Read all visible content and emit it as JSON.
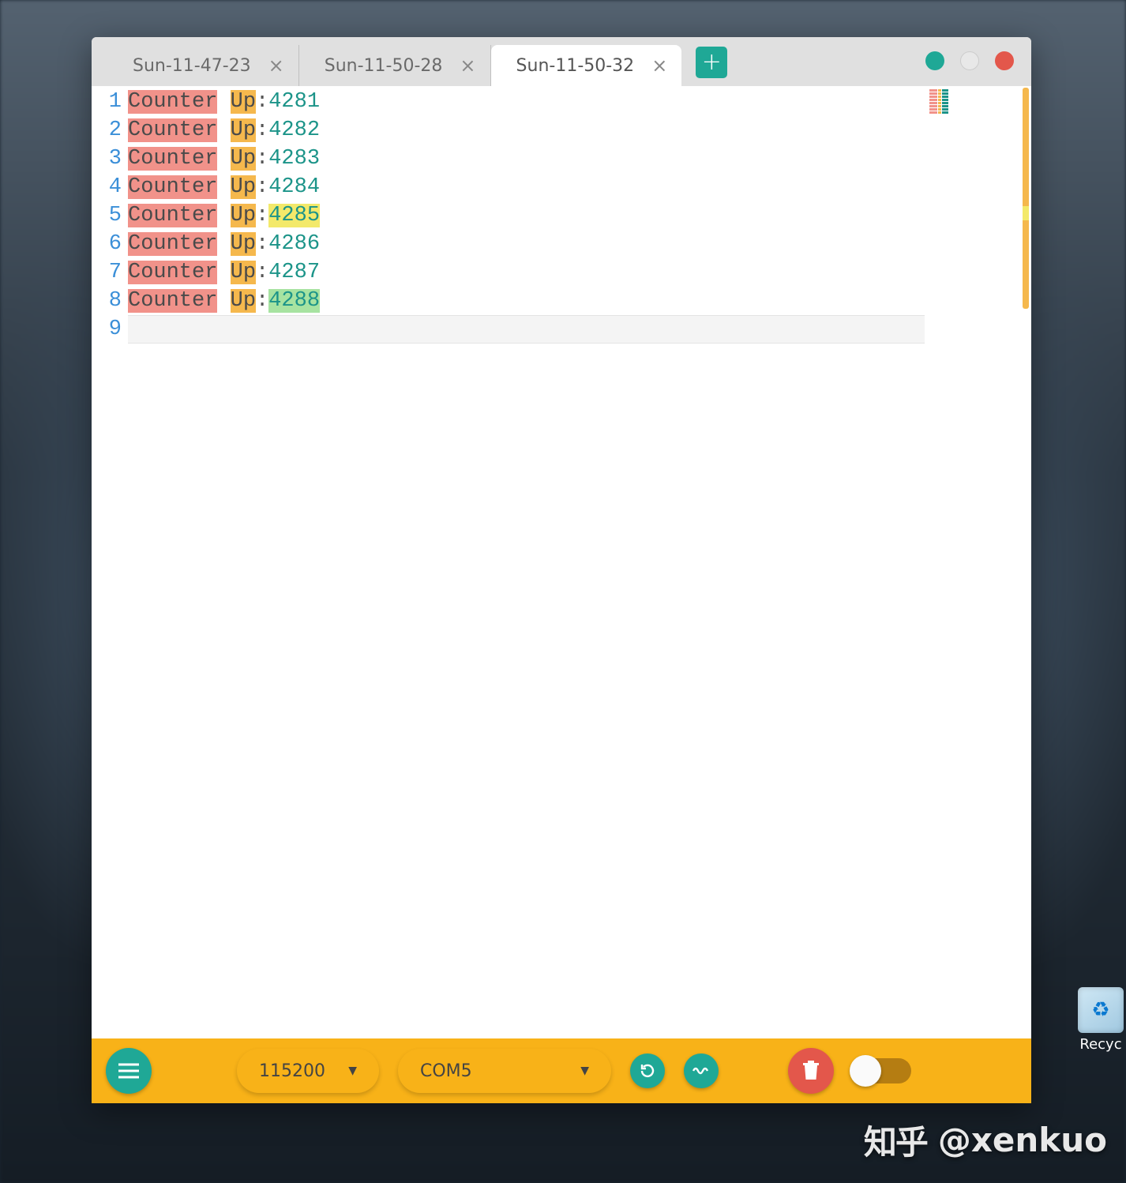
{
  "tabs": [
    {
      "label": "Sun-11-47-23",
      "active": false
    },
    {
      "label": "Sun-11-50-28",
      "active": false
    },
    {
      "label": "Sun-11-50-32",
      "active": true
    }
  ],
  "editor": {
    "lines": [
      {
        "n": "1",
        "counter": "Counter",
        "up": "Up",
        "sep": ":",
        "val": "4281",
        "hl": ""
      },
      {
        "n": "2",
        "counter": "Counter",
        "up": "Up",
        "sep": ":",
        "val": "4282",
        "hl": ""
      },
      {
        "n": "3",
        "counter": "Counter",
        "up": "Up",
        "sep": ":",
        "val": "4283",
        "hl": ""
      },
      {
        "n": "4",
        "counter": "Counter",
        "up": "Up",
        "sep": ":",
        "val": "4284",
        "hl": ""
      },
      {
        "n": "5",
        "counter": "Counter",
        "up": "Up",
        "sep": ":",
        "val": "4285",
        "hl": "y"
      },
      {
        "n": "6",
        "counter": "Counter",
        "up": "Up",
        "sep": ":",
        "val": "4286",
        "hl": ""
      },
      {
        "n": "7",
        "counter": "Counter",
        "up": "Up",
        "sep": ":",
        "val": "4287",
        "hl": ""
      },
      {
        "n": "8",
        "counter": "Counter",
        "up": "Up",
        "sep": ":",
        "val": "4288",
        "hl": "g"
      }
    ],
    "empty_line": "9"
  },
  "toolbar": {
    "baud": "115200",
    "port": "COM5"
  },
  "desktop": {
    "recycle_label": "Recyc"
  },
  "watermark": {
    "logo": "知乎",
    "handle": "@xenkuo"
  },
  "colors": {
    "teal": "#1fa896",
    "red": "#e3574b",
    "amber": "#f8b218",
    "counter_bg": "#f1928a",
    "up_bg": "#f5b84d",
    "num_fg": "#1c9489"
  }
}
